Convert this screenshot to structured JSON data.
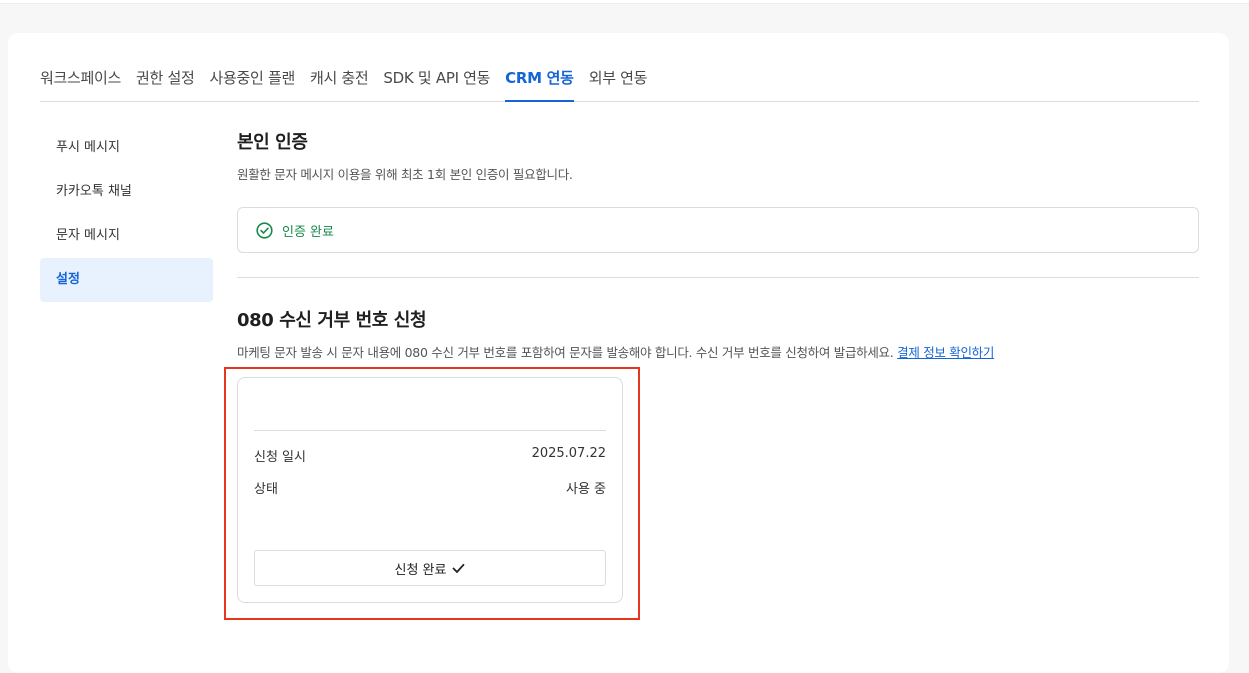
{
  "tabs": [
    {
      "label": "워크스페이스"
    },
    {
      "label": "권한 설정"
    },
    {
      "label": "사용중인 플랜"
    },
    {
      "label": "캐시 충전"
    },
    {
      "label": "SDK 및 API 연동"
    },
    {
      "label": "CRM 연동",
      "active": true
    },
    {
      "label": "외부 연동"
    }
  ],
  "sidebar": {
    "items": [
      {
        "label": "푸시 메시지"
      },
      {
        "label": "카카오톡 채널"
      },
      {
        "label": "문자 메시지"
      },
      {
        "label": "설정",
        "active": true
      }
    ]
  },
  "verification": {
    "title": "본인 인증",
    "description": "원활한 문자 메시지 이용을 위해 최초 1회 본인 인증이 필요합니다.",
    "status": "인증 완료",
    "status_icon": "check-circle-icon",
    "status_color": "#17894a"
  },
  "opt_out": {
    "title": "080 수신 거부 번호 신청",
    "description": "마케팅 문자 발송 시 문자 내용에 080 수신 거부 번호를 포함하여 문자를 발송해야 합니다. 수신 거부 번호를 신청하여 발급하세요.",
    "link": "결제 정보 확인하기",
    "card": {
      "date_label": "신청 일시",
      "date_value": "2025.07.22",
      "status_label": "상태",
      "status_value": "사용 중",
      "button_label": "신청 완료",
      "button_icon": "checkmark-icon"
    }
  },
  "colors": {
    "accent": "#1565d8",
    "success": "#17894a",
    "highlight": "#e5361f"
  }
}
